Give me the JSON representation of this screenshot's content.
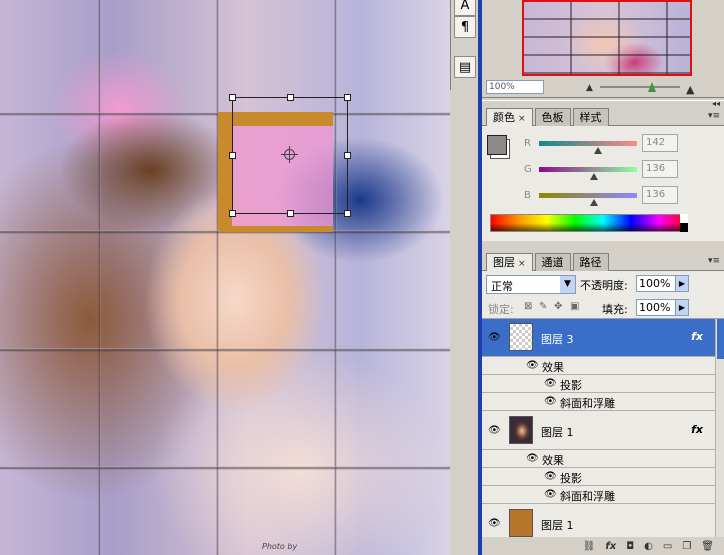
{
  "canvas": {
    "photo_credit": "Photo by"
  },
  "tools": {
    "t1": "A",
    "t2": "¶",
    "t3": "▤"
  },
  "navigator": {
    "zoom": "100%"
  },
  "color_panel": {
    "tabs": [
      "颜色",
      "色板",
      "样式"
    ],
    "close_glyph": "×",
    "channels": [
      {
        "label": "R",
        "value": "142"
      },
      {
        "label": "G",
        "value": "136"
      },
      {
        "label": "B",
        "value": "136"
      }
    ],
    "foreground": "#8e8888",
    "background": "#ffffff"
  },
  "layers_panel": {
    "tabs": [
      "图层",
      "通道",
      "路径"
    ],
    "close_glyph": "×",
    "blend_mode": "正常",
    "opacity_label": "不透明度:",
    "opacity_value": "100%",
    "lock_label": "锁定:",
    "fill_label": "填充:",
    "fill_value": "100%",
    "layers": [
      {
        "name": "图层 3",
        "fx": "fx",
        "effects_label": "效果",
        "effects": [
          "投影",
          "斜面和浮雕"
        ]
      },
      {
        "name": "图层 1",
        "fx": "fx",
        "effects_label": "效果",
        "effects": [
          "投影",
          "斜面和浮雕"
        ]
      },
      {
        "name": "图层 1"
      }
    ]
  },
  "colors": {
    "accent": "#3a6ec8",
    "dock_border": "#1e3fa8"
  }
}
